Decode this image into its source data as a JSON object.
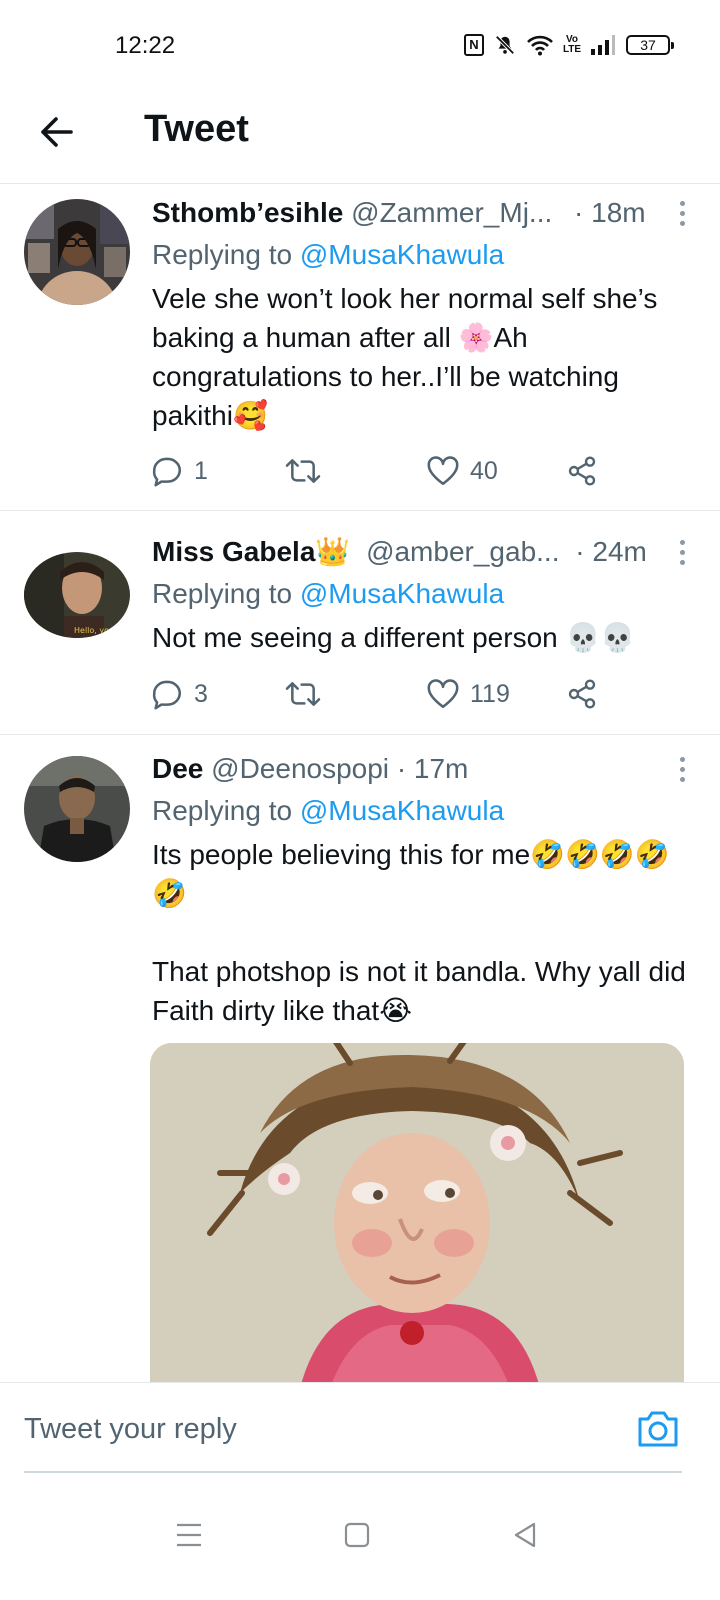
{
  "status_bar": {
    "time": "12:22",
    "nfc": "N",
    "volte": "Vo LTE",
    "battery": "37"
  },
  "header": {
    "title": "Tweet"
  },
  "tweets": [
    {
      "name": "Sthomb’esihle",
      "handle": "@Zammer_Mj...",
      "time": "· 18m",
      "replying_prefix": "Replying to",
      "replying_handle": "@MusaKhawula",
      "text": "Vele she won’t look her normal self she’s baking a human after all 🌸Ah congratulations to her..I’ll be watching pakithi🥰",
      "replies": "1",
      "retweets": "",
      "likes": "40"
    },
    {
      "name": "Miss Gabela👑",
      "handle": "@amber_gab...",
      "time": "· 24m",
      "replying_prefix": "Replying to",
      "replying_handle": "@MusaKhawula",
      "text": "Not me seeing a different person 💀💀",
      "replies": "3",
      "retweets": "",
      "likes": "119",
      "avatar_caption": "Hello, you"
    },
    {
      "name": "Dee",
      "handle": "@Deenospopi",
      "time": "· 17m",
      "replying_prefix": "Replying to",
      "replying_handle": "@MusaKhawula",
      "text": "Its people believing this for me🤣🤣🤣🤣🤣",
      "text2": "That photshop is not it bandla. Why yall did Faith dirty like that😭"
    }
  ],
  "reply_bar": {
    "placeholder": "Tweet your reply"
  },
  "icons": {
    "back": "arrow-left-icon",
    "more": "more-vertical-icon",
    "reply": "comment-icon",
    "retweet": "retweet-icon",
    "like": "heart-icon",
    "share": "share-icon",
    "camera": "camera-icon",
    "nav_menu": "menu-icon",
    "nav_home": "home-square-icon",
    "nav_back": "back-triangle-icon"
  },
  "colors": {
    "link": "#1d9bf0",
    "secondary_text": "#536471",
    "primary_text": "#0f1419"
  }
}
